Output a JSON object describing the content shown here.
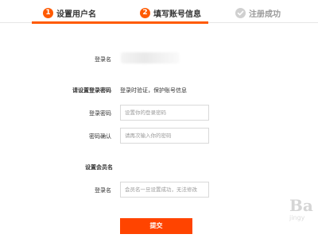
{
  "steps": [
    {
      "number": "1",
      "label": "设置用户名",
      "state": "active"
    },
    {
      "number": "2",
      "label": "填写账号信息",
      "state": "active"
    },
    {
      "number": "",
      "label": "注册成功",
      "state": "pending"
    }
  ],
  "colors": {
    "accent": "#ff5a00",
    "pending": "#cccccc"
  },
  "form": {
    "username_label": "登录名",
    "password_section_label": "请设置登录密码",
    "password_section_note": "登录时验证，保护账号信息",
    "password_label": "登录密码",
    "password_placeholder": "设置你的登录密码",
    "confirm_label": "密码确认",
    "confirm_placeholder": "请再次输入你的密码",
    "member_section_label": "设置会员名",
    "member_label": "登录名",
    "member_placeholder": "会员名一旦设置成功，无法修改",
    "submit_label": "提交"
  },
  "watermark": {
    "text_large": "Ba",
    "text_small": "jingy"
  }
}
